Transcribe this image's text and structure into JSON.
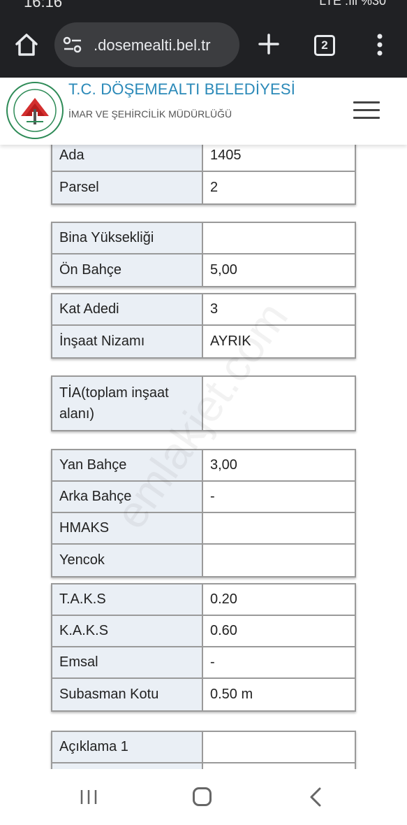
{
  "status": {
    "time": "16:16",
    "right": "LTE .ıll %30"
  },
  "browser": {
    "url": ".dosemealti.bel.tr",
    "tab_count": "2",
    "icons": [
      "home-icon",
      "site-settings-icon",
      "plus-icon",
      "tab-switcher-icon",
      "more-vert-icon"
    ]
  },
  "site": {
    "title": "T.C. DÖŞEMEALTI BELEDİYESİ",
    "subtitle": "İMAR VE ŞEHİRCİLİK MÜDÜRLÜĞÜ",
    "logo_text": "DÖŞEMEALTI BELEDİYESİ",
    "accent": "#2a89b8"
  },
  "tables": [
    {
      "rows": [
        {
          "label": "Ada",
          "value": "1405"
        },
        {
          "label": "Parsel",
          "value": "2"
        }
      ]
    },
    {
      "rows": [
        {
          "label": "Bina Yüksekliği",
          "value": ""
        },
        {
          "label": "Ön Bahçe",
          "value": "5,00"
        }
      ]
    },
    {
      "rows": [
        {
          "label": "Kat Adedi",
          "value": "3"
        },
        {
          "label": "İnşaat Nizamı",
          "value": "AYRIK"
        }
      ]
    },
    {
      "rows": [
        {
          "label": "TİA(toplam inşaat alanı)",
          "value": ""
        }
      ]
    },
    {
      "rows": [
        {
          "label": "Yan Bahçe",
          "value": "3,00"
        },
        {
          "label": "Arka Bahçe",
          "value": "-"
        },
        {
          "label": "HMAKS",
          "value": ""
        },
        {
          "label": "Yencok",
          "value": ""
        }
      ]
    },
    {
      "rows": [
        {
          "label": "T.A.K.S",
          "value": "0.20"
        },
        {
          "label": "K.A.K.S",
          "value": "0.60"
        },
        {
          "label": "Emsal",
          "value": "-"
        },
        {
          "label": "Subasman Kotu",
          "value": "0.50 m"
        }
      ]
    },
    {
      "rows": [
        {
          "label": "Açıklama 1",
          "value": ""
        },
        {
          "label": "",
          "value": ""
        }
      ]
    }
  ],
  "watermark": "emlakjet.com"
}
